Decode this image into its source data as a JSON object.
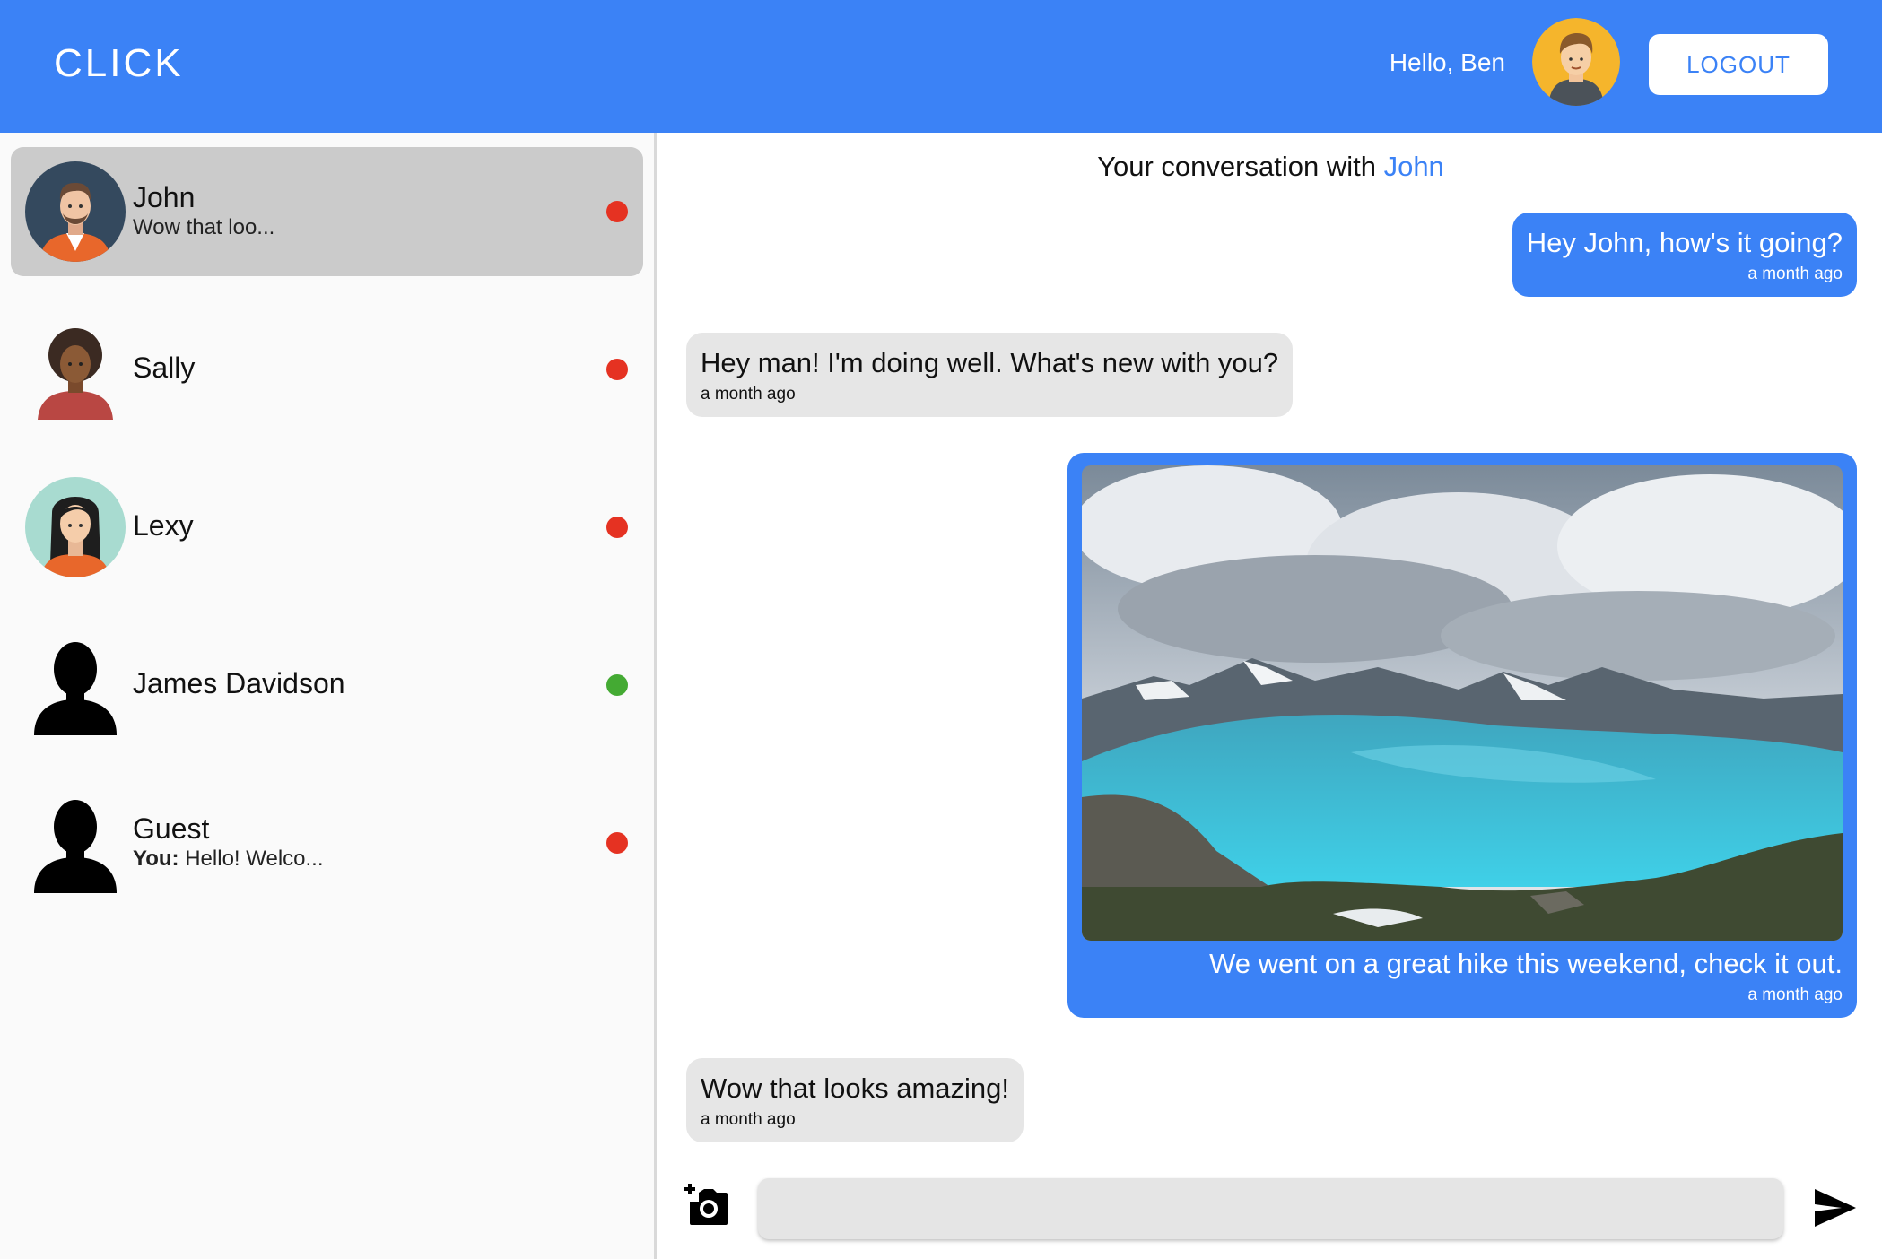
{
  "header": {
    "brand": "CLICK",
    "greeting": "Hello, Ben",
    "avatar_icon": "user-avatar-icon",
    "logout_label": "LOGOUT",
    "bg_color": "#3b82f6"
  },
  "contacts": [
    {
      "name": "John",
      "preview": "Wow that loo...",
      "preview_prefix": "",
      "status": "offline",
      "status_color": "#e53222",
      "active": true,
      "avatar_icon": "john-avatar-icon"
    },
    {
      "name": "Sally",
      "preview": "",
      "preview_prefix": "",
      "status": "offline",
      "status_color": "#e53222",
      "active": false,
      "avatar_icon": "sally-avatar-icon"
    },
    {
      "name": "Lexy",
      "preview": "",
      "preview_prefix": "",
      "status": "offline",
      "status_color": "#e53222",
      "active": false,
      "avatar_icon": "lexy-avatar-icon"
    },
    {
      "name": "James Davidson",
      "preview": "",
      "preview_prefix": "",
      "status": "online",
      "status_color": "#44aa33",
      "active": false,
      "avatar_icon": "person-silhouette-icon"
    },
    {
      "name": "Guest",
      "preview": "Hello! Welco...",
      "preview_prefix": "You:",
      "status": "offline",
      "status_color": "#e53222",
      "active": false,
      "avatar_icon": "person-silhouette-icon"
    }
  ],
  "chat": {
    "title_prefix": "Your conversation with",
    "peer_name": "John",
    "messages": [
      {
        "direction": "out",
        "text": "Hey John, how's it going?",
        "time": "a month ago"
      },
      {
        "direction": "in",
        "text": "Hey man! I'm doing well. What's new with you?",
        "time": "a month ago"
      },
      {
        "direction": "out",
        "text": "We went on a great hike this weekend, check it out.",
        "time": "a month ago",
        "image_icon": "mountain-lake-photo"
      },
      {
        "direction": "in",
        "text": "Wow that looks amazing!",
        "time": "a month ago"
      }
    ],
    "composer": {
      "camera_icon": "add-photo-camera-icon",
      "input_value": "",
      "input_placeholder": "",
      "send_icon": "send-icon"
    }
  }
}
